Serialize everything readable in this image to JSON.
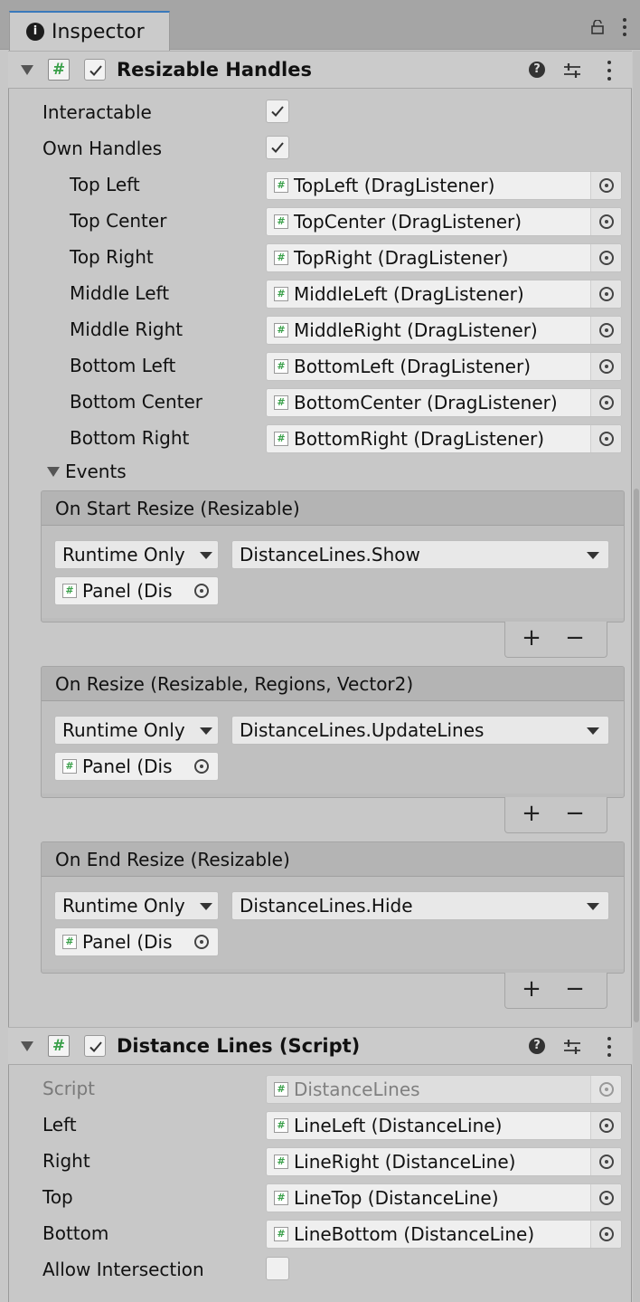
{
  "window": {
    "tab_title": "Inspector"
  },
  "resizable": {
    "title": "Resizable Handles",
    "interactable_label": "Interactable",
    "interactable_checked": true,
    "own_handles_label": "Own Handles",
    "own_handles_checked": true,
    "handles": [
      {
        "label": "Top Left",
        "value": "TopLeft (DragListener)"
      },
      {
        "label": "Top Center",
        "value": "TopCenter (DragListener)"
      },
      {
        "label": "Top Right",
        "value": "TopRight (DragListener)"
      },
      {
        "label": "Middle Left",
        "value": "MiddleLeft (DragListener)"
      },
      {
        "label": "Middle Right",
        "value": "MiddleRight (DragListener)"
      },
      {
        "label": "Bottom Left",
        "value": "BottomLeft (DragListener)"
      },
      {
        "label": "Bottom Center",
        "value": "BottomCenter (DragListener)"
      },
      {
        "label": "Bottom Right",
        "value": "BottomRight (DragListener)"
      }
    ],
    "events_label": "Events",
    "events": [
      {
        "header": "On Start Resize (Resizable)",
        "mode": "Runtime Only",
        "function": "DistanceLines.Show",
        "target": "Panel (Dis"
      },
      {
        "header": "On Resize (Resizable, Regions, Vector2)",
        "mode": "Runtime Only",
        "function": "DistanceLines.UpdateLines",
        "target": "Panel (Dis"
      },
      {
        "header": "On End Resize (Resizable)",
        "mode": "Runtime Only",
        "function": "DistanceLines.Hide",
        "target": "Panel (Dis"
      }
    ]
  },
  "distance_lines": {
    "title": "Distance Lines (Script)",
    "script_label": "Script",
    "script_value": "DistanceLines",
    "fields": [
      {
        "label": "Left",
        "value": "LineLeft (DistanceLine)"
      },
      {
        "label": "Right",
        "value": "LineRight (DistanceLine)"
      },
      {
        "label": "Top",
        "value": "LineTop (DistanceLine)"
      },
      {
        "label": "Bottom",
        "value": "LineBottom (DistanceLine)"
      }
    ],
    "allow_intersection_label": "Allow Intersection",
    "allow_intersection_checked": false
  },
  "glyphs": {
    "plus": "+",
    "minus": "−",
    "script_hash": "#",
    "info": "i",
    "help": "?"
  },
  "colors": {
    "accent": "#3a79bb",
    "script_icon": "#3aa04a",
    "panel_bg": "#c8c8c8"
  }
}
